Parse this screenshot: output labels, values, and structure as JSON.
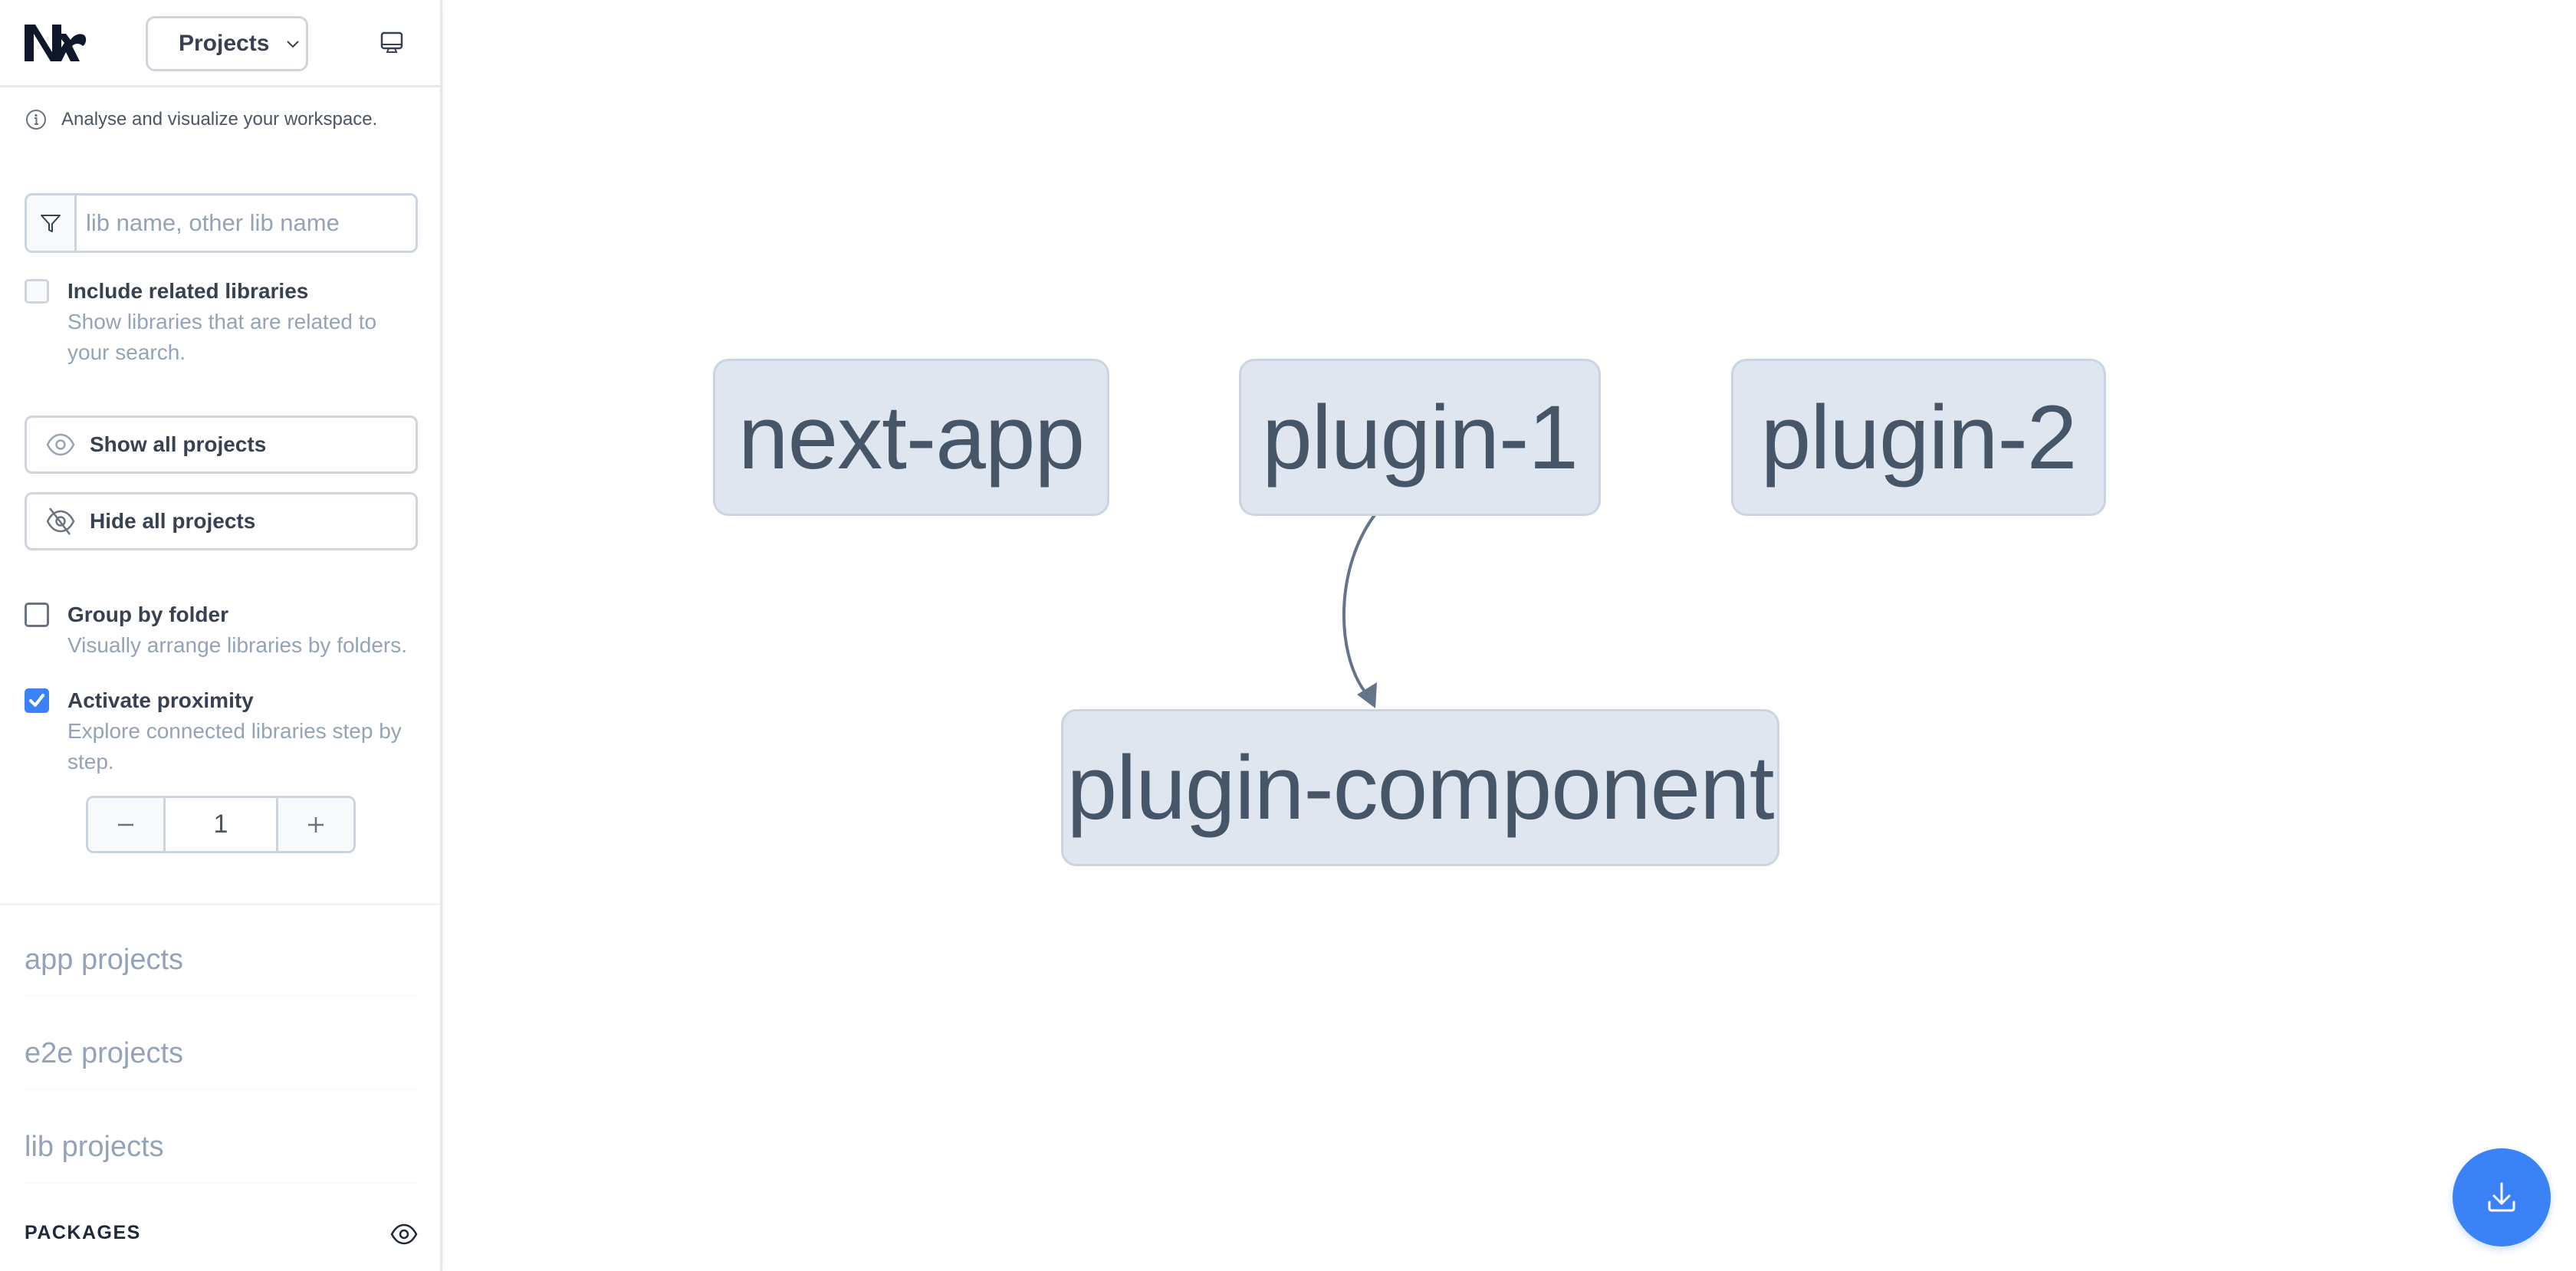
{
  "header": {
    "logo": "nx-logo",
    "view_select": {
      "selected": "Projects",
      "icon": "chevron-down-icon"
    },
    "render_mode_icon": "monitor-icon"
  },
  "info": {
    "icon": "info-icon",
    "text": "Analyse and visualize your workspace."
  },
  "filter": {
    "icon": "funnel-icon",
    "value": "",
    "placeholder": "lib name, other lib name"
  },
  "include_related": {
    "checked": false,
    "disabled": true,
    "title": "Include related libraries",
    "description": "Show libraries that are related to your search."
  },
  "buttons": {
    "show_all": {
      "label": "Show all projects",
      "icon": "eye-icon"
    },
    "hide_all": {
      "label": "Hide all projects",
      "icon": "eye-slash-icon"
    }
  },
  "group_by_folder": {
    "checked": false,
    "title": "Group by folder",
    "description": "Visually arrange libraries by folders."
  },
  "proximity": {
    "checked": true,
    "title": "Activate proximity",
    "description": "Explore connected libraries step by step.",
    "stepper": {
      "value": "1",
      "decrement_icon": "minus-icon",
      "increment_icon": "plus-icon"
    }
  },
  "project_groups": [
    {
      "title": "app projects"
    },
    {
      "title": "e2e projects"
    },
    {
      "title": "lib projects"
    }
  ],
  "packages": {
    "label": "PACKAGES",
    "icon": "eye-icon"
  },
  "graph": {
    "nodes": [
      {
        "id": "next-app",
        "label": "next-app"
      },
      {
        "id": "plugin-1",
        "label": "plugin-1"
      },
      {
        "id": "plugin-2",
        "label": "plugin-2"
      },
      {
        "id": "plugin-component",
        "label": "plugin-component"
      }
    ],
    "edges": [
      {
        "from": "plugin-1",
        "to": "plugin-component"
      }
    ],
    "colors": {
      "node_fill": "#e0e6ef",
      "node_border": "#cbd5e1",
      "node_text": "#475569",
      "edge": "#64748b"
    }
  },
  "download_button": {
    "icon": "download-icon",
    "color": "#3b82f6"
  }
}
